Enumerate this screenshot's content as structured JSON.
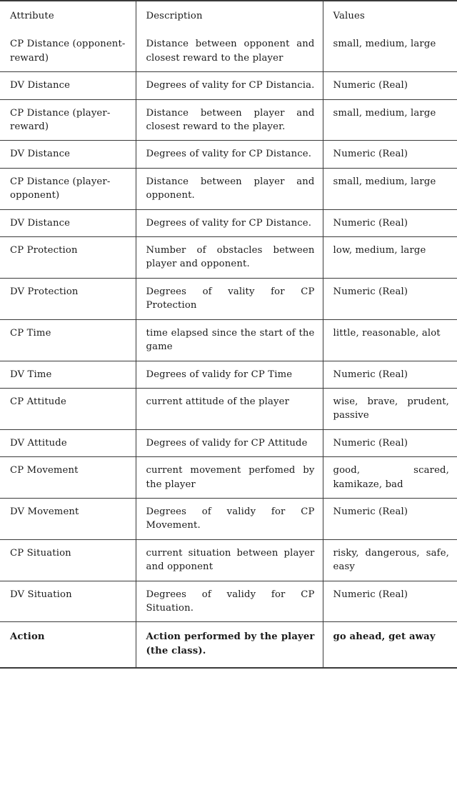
{
  "table": {
    "columns": [
      "Attribute",
      "Description",
      "Values"
    ],
    "rows": [
      {
        "attribute": "CP Distance (opponent-reward)",
        "description": "Distance between opponent and closest reward to the player",
        "values": "small, medium, large",
        "bold": false
      },
      {
        "attribute": "DV Distance",
        "description": "Degrees of vality for CP Distancia.",
        "values": "Numeric (Real)",
        "bold": false
      },
      {
        "attribute": "CP Distance (player-reward)",
        "description": "Distance between player and closest reward to the player.",
        "values": "small, medium, large",
        "bold": false
      },
      {
        "attribute": "DV Distance",
        "description": "Degrees of vality for CP Distance.",
        "values": "Numeric (Real)",
        "bold": false
      },
      {
        "attribute": "CP Distance (player-opponent)",
        "description": "Distance between player and opponent.",
        "values": "small, medium, large",
        "bold": false
      },
      {
        "attribute": "DV Distance",
        "description": "Degrees of vality for CP Distance.",
        "values": "Numeric (Real)",
        "bold": false
      },
      {
        "attribute": "CP Protection",
        "description": "Number of obstacles between player and opponent.",
        "values": "low, medium, large",
        "bold": false
      },
      {
        "attribute": "DV Protection",
        "description": "Degrees of vality for CP Protection",
        "values": "Numeric (Real)",
        "bold": false
      },
      {
        "attribute": "CP Time",
        "description": "time elapsed since the start of the game",
        "values": "little, reasonable, alot",
        "bold": false
      },
      {
        "attribute": "DV Time",
        "description": "Degrees of validy for CP Time",
        "values": "Numeric (Real)",
        "bold": false
      },
      {
        "attribute": "CP Attitude",
        "description": "current attitude of the player",
        "values": "wise, brave, prudent, passive",
        "bold": false
      },
      {
        "attribute": "DV Attitude",
        "description": "Degrees of validy for CP Attitude",
        "values": "Numeric (Real)",
        "bold": false
      },
      {
        "attribute": "CP Movement",
        "description": "current movement perfomed by the player",
        "values": "good, scared, kamikaze, bad",
        "bold": false
      },
      {
        "attribute": "DV Movement",
        "description": "Degrees of validy for CP Movement.",
        "values": "Numeric (Real)",
        "bold": false
      },
      {
        "attribute": "CP Situation",
        "description": "current situation between player and opponent",
        "values": "risky, dangerous, safe, easy",
        "bold": false
      },
      {
        "attribute": "DV Situation",
        "description": "Degrees of validy for CP Situation.",
        "values": "Numeric (Real)",
        "bold": false
      },
      {
        "attribute": "Action",
        "description": "Action performed by the player (the class).",
        "values": "go ahead, get away",
        "bold": true
      }
    ]
  }
}
